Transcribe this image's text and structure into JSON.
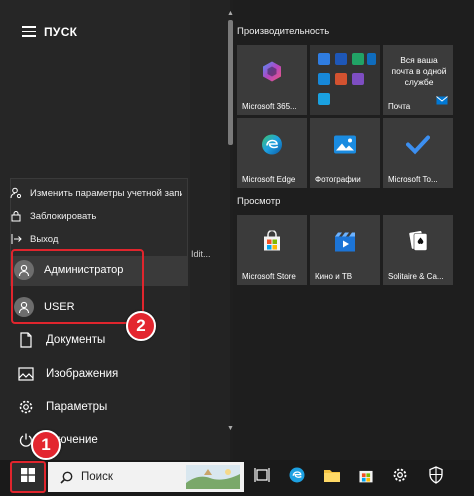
{
  "start_menu": {
    "title": "ПУСК",
    "account_menu": [
      {
        "label": "Изменить параметры учетной запис",
        "icon": "user-settings-icon"
      },
      {
        "label": "Заблокировать",
        "icon": "lock-icon"
      },
      {
        "label": "Выход",
        "icon": "sign-out-icon"
      }
    ],
    "accounts": [
      {
        "label": "Администратор",
        "icon": "avatar-icon"
      },
      {
        "label": "USER",
        "icon": "avatar-icon"
      }
    ],
    "nav": [
      {
        "label": "Документы",
        "icon": "document-icon"
      },
      {
        "label": "Изображения",
        "icon": "pictures-icon"
      },
      {
        "label": "Параметры",
        "icon": "gear-icon"
      },
      {
        "label": "ключение",
        "icon": "power-icon"
      }
    ],
    "clipped_list_text": "Idit..."
  },
  "tile_groups": [
    {
      "name": "Производительность",
      "tiles": [
        {
          "label": "",
          "icon": "office-apps-icon"
        },
        {
          "label": "",
          "icon": "office-apps-icon"
        },
        {
          "label": "Вся ваша почта в одной службе",
          "sub": "Почта",
          "icon": "mail-icon"
        },
        {
          "label": "Microsoft 365...",
          "icon": "microsoft-365-icon"
        },
        {
          "label": "Microsoft Edge",
          "icon": "edge-icon"
        },
        {
          "label": "Фотографии",
          "icon": "photos-icon"
        },
        {
          "label": "Microsoft To...",
          "icon": "todo-check-icon"
        }
      ]
    },
    {
      "name": "Просмотр",
      "tiles": [
        {
          "label": "Microsoft Store",
          "icon": "store-icon"
        },
        {
          "label": "Кино и ТВ",
          "icon": "movies-icon"
        },
        {
          "label": "Solitaire & Ca...",
          "icon": "cards-icon"
        }
      ]
    }
  ],
  "taskbar": {
    "search_placeholder": "Поиск",
    "icons": [
      "task-view-icon",
      "edge-icon",
      "file-explorer-icon",
      "store-icon",
      "gear-icon",
      "security-shield-icon"
    ]
  },
  "annotations": {
    "badge_1": "1",
    "badge_2": "2"
  },
  "colors": {
    "highlight_red": "#e0252d",
    "accent_blue": "#0078d4"
  }
}
